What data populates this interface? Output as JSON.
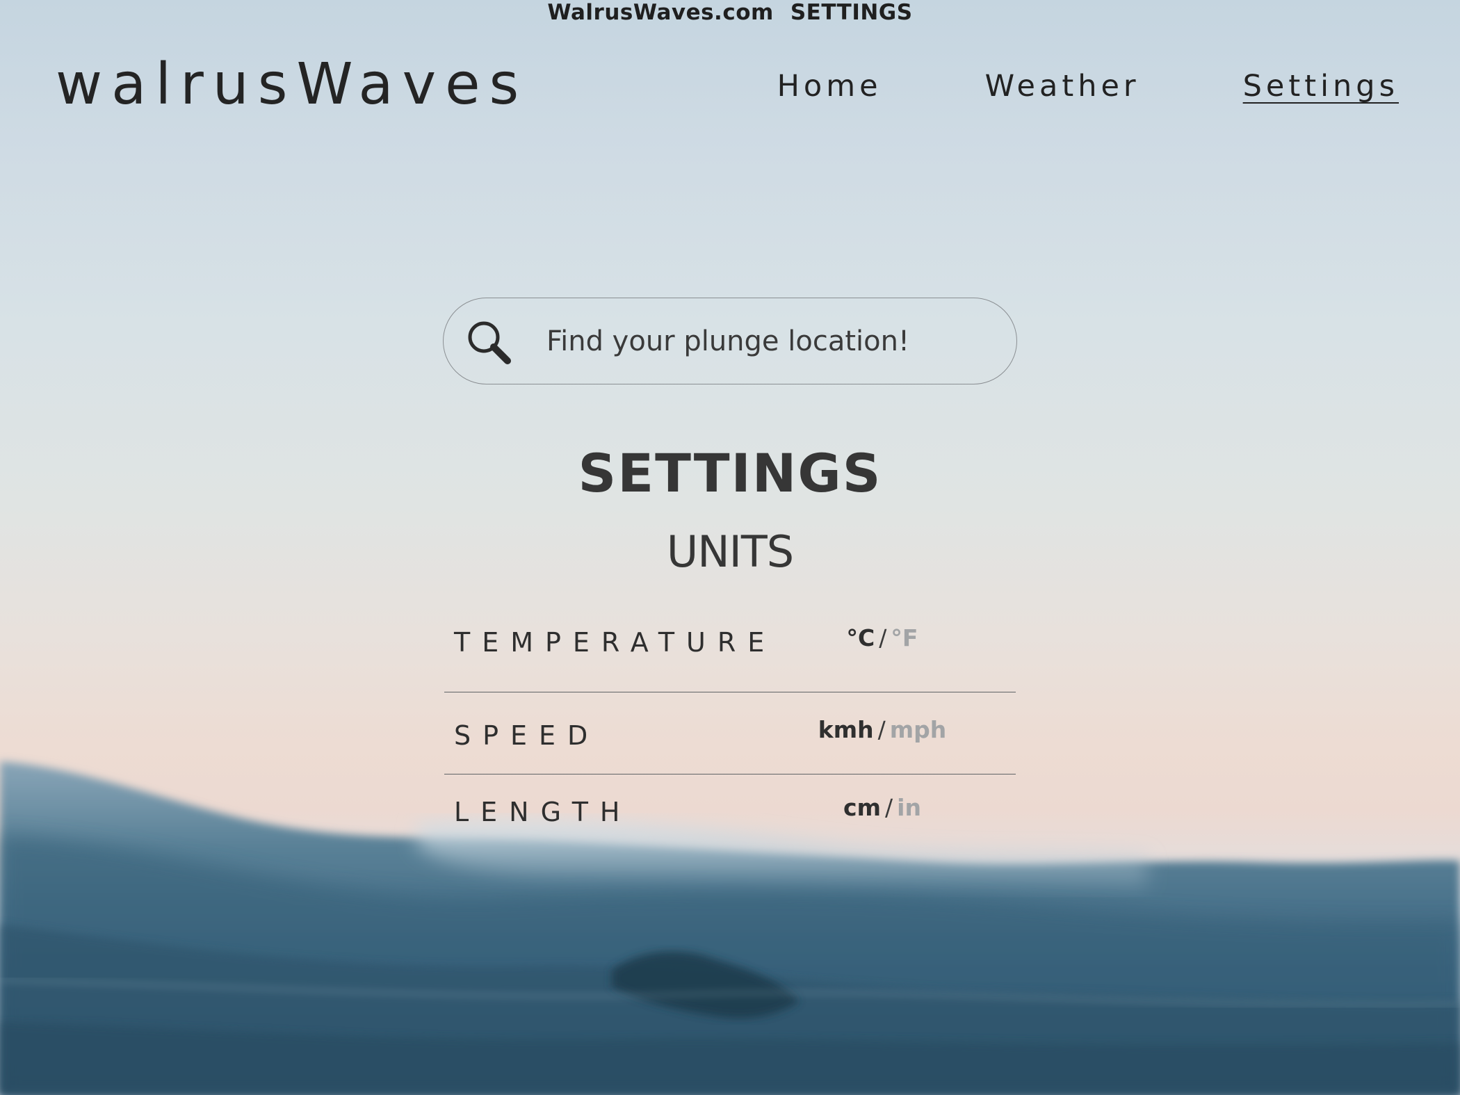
{
  "window": {
    "site": "WalrusWaves.com",
    "page": "SETTINGS"
  },
  "header": {
    "logo": "walrusWaves",
    "nav": [
      {
        "label": "Home",
        "active": false
      },
      {
        "label": "Weather",
        "active": false
      },
      {
        "label": "Settings",
        "active": true
      }
    ]
  },
  "search": {
    "placeholder": "Find your plunge location!",
    "value": "",
    "icon": "search-icon"
  },
  "settings": {
    "title": "SETTINGS",
    "section_title": "UNITS",
    "units": [
      {
        "label": "TEMPERATURE",
        "selected": "°C",
        "alternative": "°F",
        "separator": "/"
      },
      {
        "label": "SPEED",
        "selected": "kmh",
        "alternative": "mph",
        "separator": "/"
      },
      {
        "label": "LENGTH",
        "selected": "cm",
        "alternative": "in",
        "separator": "/"
      }
    ]
  },
  "colors": {
    "text_primary": "#2e2e2e",
    "unit_selected": "#2f2f2f",
    "unit_unselected": "#a2a4a6",
    "sky_top": "#c5d5e0",
    "sky_horizon": "#eddcd3",
    "sea": "#3f6a82"
  },
  "background": {
    "description_icon": "ocean-wave-background"
  }
}
